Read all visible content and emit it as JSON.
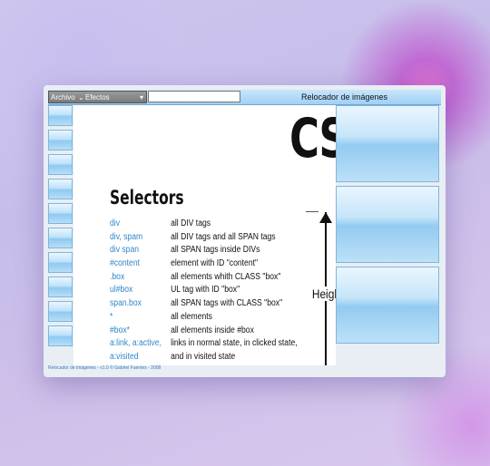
{
  "toolbar": {
    "menu_archivo": "Archivo",
    "menu_efectos": "Efectos",
    "search_value": "",
    "window_title": "Relocador de imágenes"
  },
  "content": {
    "big_heading": "CS",
    "section_heading": "Selectors",
    "side_label": "Heigh",
    "rows": [
      {
        "selector": "div",
        "desc": "all DIV tags"
      },
      {
        "selector": "div, spam",
        "desc": "all DIV tags and all SPAN tags"
      },
      {
        "selector": "div span",
        "desc": "all SPAN tags inside DIVs"
      },
      {
        "selector": "#content",
        "desc": "element with ID \"content\""
      },
      {
        "selector": ".box",
        "desc": "all elements whith CLASS \"box\""
      },
      {
        "selector": "ul#box",
        "desc": "UL tag with ID \"box\""
      },
      {
        "selector": "span.box",
        "desc": "all SPAN tags with CLASS \"box\""
      },
      {
        "selector": "*",
        "desc": "all elements"
      },
      {
        "selector": "#box*",
        "desc": "all elements inside #box"
      },
      {
        "selector": "a:link, a:active,",
        "desc": "links in normal state, in clicked state,"
      },
      {
        "selector": "a:visited",
        "desc": "and in visited state"
      }
    ]
  },
  "status": {
    "text": "Relocador de imágenes - v1.0 © Gabriel Fuentes - 2008"
  },
  "colors": {
    "accent_link": "#2f86c9",
    "toolbar": "#9fd0f6"
  }
}
